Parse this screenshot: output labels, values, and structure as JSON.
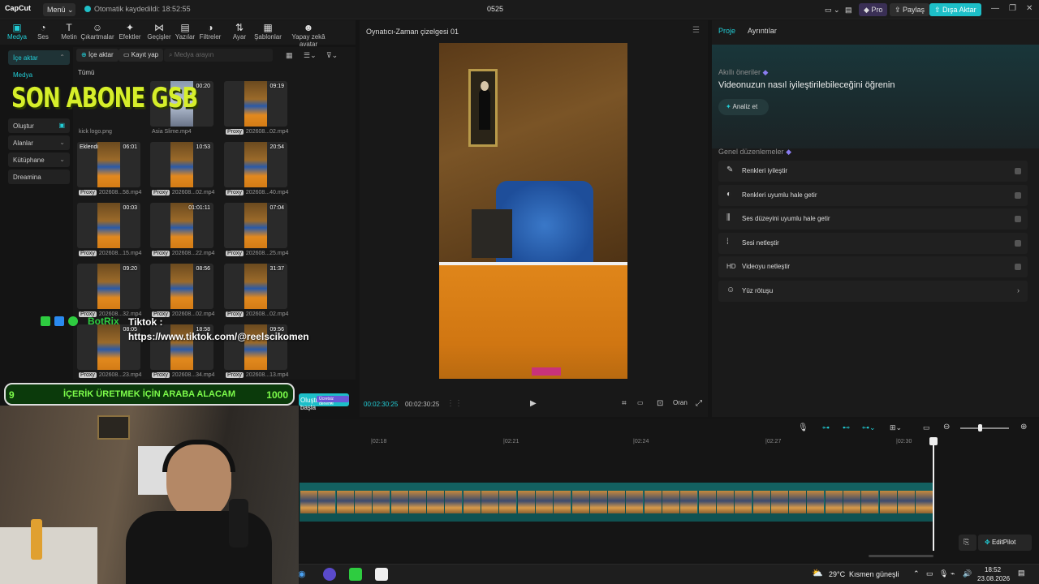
{
  "topbar": {
    "logo": "CapCut",
    "menu": "Menü",
    "autosave": "Otomatik kaydedildi: 18:52:55",
    "title": "0525",
    "pro": "Pro",
    "share": "Paylaş",
    "export": "Dışa Aktar"
  },
  "tooltabs": [
    {
      "label": "Medya",
      "icon": "▣"
    },
    {
      "label": "Ses",
      "icon": "◔"
    },
    {
      "label": "Metin",
      "icon": "T"
    },
    {
      "label": "Çıkartmalar",
      "icon": "☺"
    },
    {
      "label": "Efektler",
      "icon": "✦"
    },
    {
      "label": "Geçişler",
      "icon": "⋈"
    },
    {
      "label": "Yazılar",
      "icon": "▤"
    },
    {
      "label": "Filtreler",
      "icon": "◑"
    },
    {
      "label": "Ayar",
      "icon": "⇅"
    },
    {
      "label": "Şablonlar",
      "icon": "▦"
    },
    {
      "label": "Yapay zekâ avatar",
      "icon": "☻"
    }
  ],
  "leftnav": {
    "import": "İçe aktar",
    "media": "Medya",
    "create": "Oluştur",
    "spaces": "Alanlar",
    "library": "Kütüphane",
    "dreamina": "Dreamina"
  },
  "media_toolbar": {
    "import": "İçe aktar",
    "record": "Kayıt yap",
    "search_placeholder": "Medya arayın",
    "all": "Tümü"
  },
  "media_items": [
    {
      "name": "kick logo.png",
      "duration": "",
      "proxy": false,
      "tag": ""
    },
    {
      "name": "Asia Slime.mp4",
      "duration": "00:20",
      "proxy": false,
      "tag": ""
    },
    {
      "name": "202608...02.mp4",
      "duration": "09:19",
      "proxy": true,
      "tag": ""
    },
    {
      "name": "202608...58.mp4",
      "duration": "06:01",
      "proxy": true,
      "tag": "Eklendi"
    },
    {
      "name": "202608...02.mp4",
      "duration": "10:53",
      "proxy": true,
      "tag": ""
    },
    {
      "name": "202608...40.mp4",
      "duration": "20:54",
      "proxy": true,
      "tag": ""
    },
    {
      "name": "202608...15.mp4",
      "duration": "00:03",
      "proxy": true,
      "tag": ""
    },
    {
      "name": "202608...22.mp4",
      "duration": "01:01:11",
      "proxy": true,
      "tag": ""
    },
    {
      "name": "202608...25.mp4",
      "duration": "07:04",
      "proxy": true,
      "tag": ""
    },
    {
      "name": "202608...32.mp4",
      "duration": "09:20",
      "proxy": true,
      "tag": ""
    },
    {
      "name": "202608...02.mp4",
      "duration": "08:56",
      "proxy": true,
      "tag": ""
    },
    {
      "name": "202608...02.mp4",
      "duration": "31:37",
      "proxy": true,
      "tag": ""
    },
    {
      "name": "202608...23.mp4",
      "duration": "08:05",
      "proxy": true,
      "tag": ""
    },
    {
      "name": "202608...34.mp4",
      "duration": "18:58",
      "proxy": true,
      "tag": ""
    },
    {
      "name": "202608...13.mp4",
      "duration": "09:56",
      "proxy": true,
      "tag": ""
    }
  ],
  "player": {
    "title": "Oynatıcı-Zaman çizelgesi 01",
    "current": "00:02:30:25",
    "total": "00:02:30:25",
    "ratio": "Oran"
  },
  "rpanel": {
    "tab_project": "Proje",
    "tab_details": "Ayrıntılar",
    "smart_title": "Akıllı öneriler",
    "smart_desc": "Videonuzun nasıl iyileştirilebileceğini öğrenin",
    "analyze": "Analiz et",
    "general_title": "Genel düzenlemeler",
    "options": [
      {
        "label": "Renkleri iyileştir",
        "icon": "✎"
      },
      {
        "label": "Renkleri uyumlu hale getir",
        "icon": "◐"
      },
      {
        "label": "Ses düzeyini uyumlu hale getir",
        "icon": "⫼"
      },
      {
        "label": "Sesi netleştir",
        "icon": "⁞"
      },
      {
        "label": "Videoyu netleştir",
        "icon": "HD"
      },
      {
        "label": "Yüz rötuşu",
        "icon": "☺"
      }
    ]
  },
  "timeline": {
    "ticks": [
      "|02:18",
      "|02:21",
      "|02:24",
      "|02:27",
      "|02:30"
    ],
    "editpilot": "EditPilot",
    "generate_badge": "Ücretsiz deneme",
    "generate": "Oluşturmaya başla"
  },
  "overlays": {
    "sonabone": "SON ABONE GSB",
    "botrix": "BotRix",
    "tiktok": "Tiktok : https://www.tiktok.com/@reelscikomen",
    "goal_left": "9",
    "goal_text": "İÇERİK ÜRETMEK İÇİN ARABA ALACAM",
    "goal_right": "1000"
  },
  "taskbar": {
    "temp": "29°C",
    "weather": "Kısmen güneşli",
    "time": "18:52",
    "date": "23.08.2026"
  },
  "colors": {
    "accent": "#22cfd8",
    "track": "#1a6c6c",
    "goal_green": "#7cfc4a"
  }
}
